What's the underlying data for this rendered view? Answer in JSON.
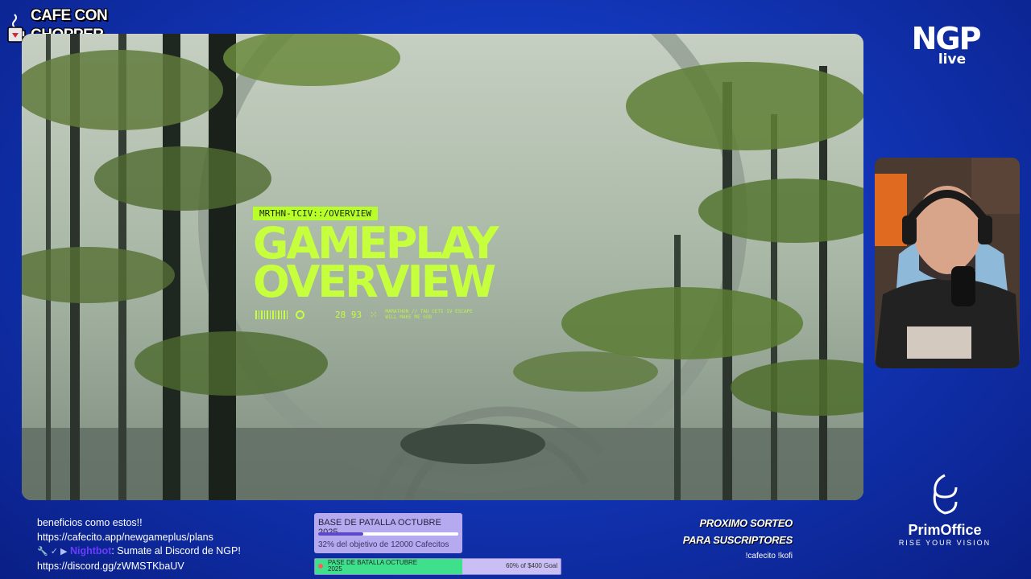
{
  "overlay": {
    "logo_left": {
      "line1": "CAFE CON",
      "line2": "CHOPPER"
    },
    "logo_right": {
      "big": "NGP",
      "small": "live"
    },
    "sponsor": {
      "name": "PrimOffice",
      "tagline": "RISE YOUR VISION"
    }
  },
  "game": {
    "tag": "MRTHN-TCIV::/OVERVIEW",
    "title_line1": "GAMEPLAY",
    "title_line2": "OVERVIEW",
    "counter": "28 93",
    "fine_print": "MARATHON // TAU CETI IV ESCAPE WILL MAKE ME GOD"
  },
  "chat": [
    {
      "text": "beneficios como estos!!"
    },
    {
      "text": "https://cafecito.app/newgameplus/plans"
    },
    {
      "badges": "🔧 ✓ ▶",
      "user": "Nightbot",
      "text": ": Sumate al Discord de NGP!"
    },
    {
      "text": "https://discord.gg/zWMSTKbaUV"
    }
  ],
  "goal_primary": {
    "title": "BASE DE PATALLA OCTUBRE 2025",
    "subtitle": "32% del objetivo de 12000 Cafecitos",
    "progress": 0.32
  },
  "goal_secondary": {
    "title": "PASE DE BATALLA OCTUBRE 2025",
    "amount": "60% of $400 Goal",
    "progress": 0.6
  },
  "sorteo": {
    "line1": "PROXIMO SORTEO",
    "line2": "PARA SUSCRIPTORES",
    "line3": "!cafecito !kofi"
  },
  "colors": {
    "background": "#1236b8",
    "hud_accent": "#c6ff3c",
    "goal_fill": "#5d48c8",
    "goal2_fill": "#3ee08c"
  }
}
